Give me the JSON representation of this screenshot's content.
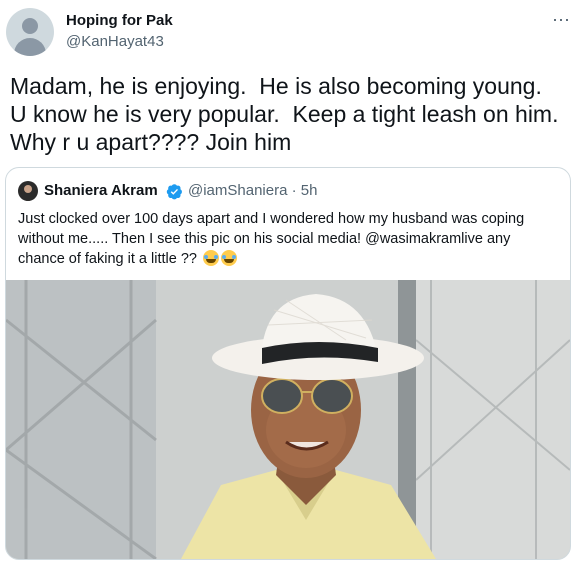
{
  "author": {
    "display_name": "Hoping for Pak",
    "handle": "@KanHayat43",
    "avatar_icon": "default-avatar-icon"
  },
  "more_icon": "⋯",
  "tweet_text": "Madam, he is enjoying.  He is also becoming young.  U know he is very popular.  Keep a tight leash on him.  Why r u apart???? Join him",
  "quoted": {
    "display_name": "Shaniera Akram",
    "verified": true,
    "handle_time": "@iamShaniera · 5h",
    "text": "Just clocked over 100 days apart and I wondered how my husband was coping without me..... Then I see this pic on his social media! @wasimakramlive any chance of faking it a little ?? ",
    "emojis": [
      "face-with-tears-of-joy",
      "face-with-tears-of-joy"
    ],
    "photo_icon": "photo-man-in-white-hat-and-sunglasses"
  },
  "colors": {
    "text": "#0f1419",
    "secondary": "#536471",
    "border": "#cfd9de",
    "verified": "#1d9bf0"
  }
}
